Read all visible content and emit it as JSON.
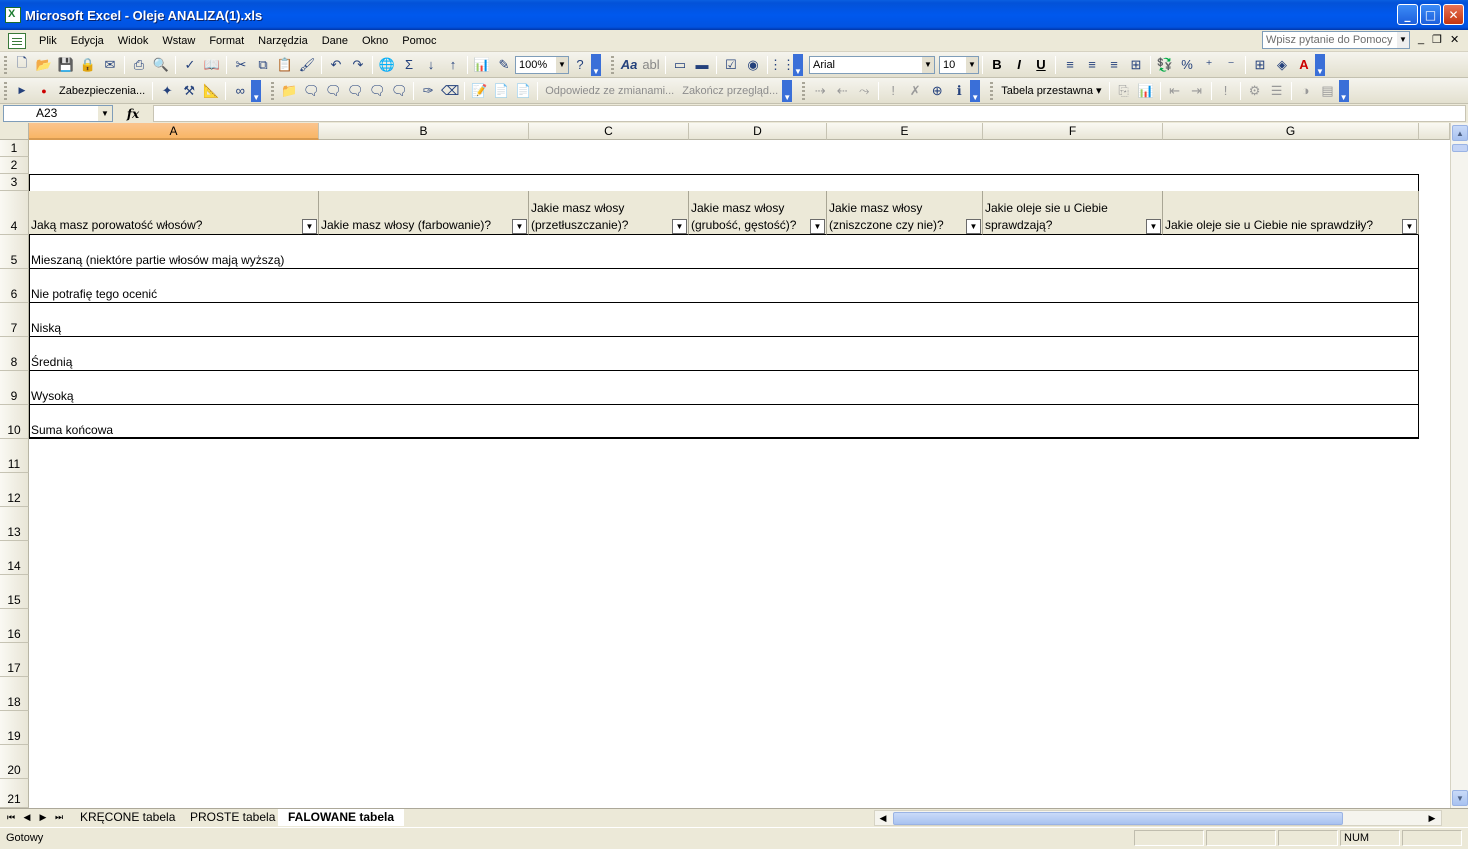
{
  "window": {
    "title": "Microsoft Excel - Oleje ANALIZA(1).xls"
  },
  "menubar": {
    "items": [
      "Plik",
      "Edycja",
      "Widok",
      "Wstaw",
      "Format",
      "Narzędzia",
      "Dane",
      "Okno",
      "Pomoc"
    ],
    "help_placeholder": "Wpisz pytanie do Pomocy"
  },
  "toolbar": {
    "zoom": "100%",
    "font": "Arial",
    "font_size": "10",
    "security_label": "Zabezpieczenia...",
    "reply_changes": "Odpowiedz ze zmianami...",
    "end_review": "Zakończ przegląd...",
    "pivot_table": "Tabela przestawna"
  },
  "formula_bar": {
    "name_box": "A23",
    "fx": "fx",
    "formula": ""
  },
  "columns": [
    "A",
    "B",
    "C",
    "D",
    "E",
    "F",
    "G"
  ],
  "rows": [
    "1",
    "2",
    "3",
    "4",
    "5",
    "6",
    "7",
    "8",
    "9",
    "10",
    "11",
    "12",
    "13",
    "14",
    "15",
    "16",
    "17",
    "18",
    "19",
    "20",
    "21"
  ],
  "pivot": {
    "headers": [
      "Jaką masz porowatość włosów?",
      "Jakie masz włosy (farbowanie)?",
      "Jakie masz włosy\n(przetłuszczanie)?",
      "Jakie masz włosy\n(grubość, gęstość)?",
      "Jakie masz włosy\n(zniszczone czy nie)?",
      "Jakie oleje sie u Ciebie\nsprawdzają?",
      "Jakie oleje sie u Ciebie nie sprawdziły?"
    ],
    "rows": [
      "Mieszaną (niektóre partie włosów mają wyższą)",
      "Nie potrafię tego ocenić",
      "Niską",
      "Średnią",
      "Wysoką",
      "Suma końcowa"
    ]
  },
  "sheets": {
    "tabs": [
      "KRĘCONE tabela",
      "PROSTE tabela",
      "FALOWANE tabela"
    ],
    "active": "FALOWANE tabela"
  },
  "status": {
    "text": "Gotowy",
    "num": "NUM"
  }
}
